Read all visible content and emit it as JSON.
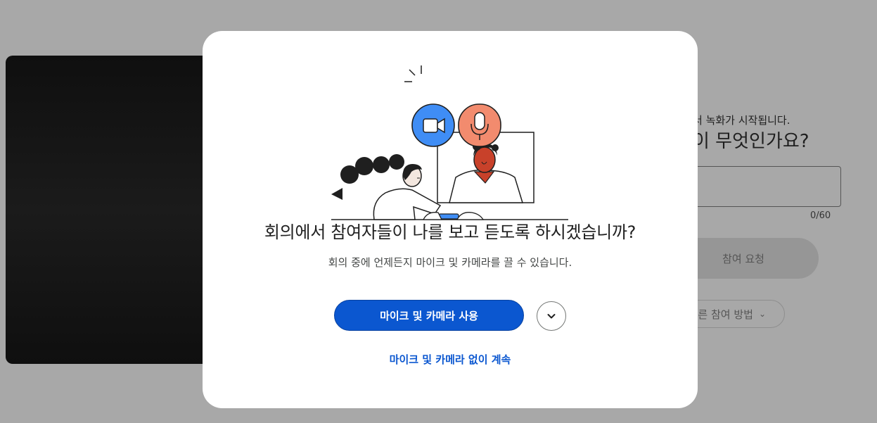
{
  "background": {
    "recording_notice": "서 녹화가 시작됩니다.",
    "name_question": "이 무엇인가요?",
    "name_counter": "0/60",
    "join_button_label": "참여 요청",
    "other_ways_label": "른 참여 방법"
  },
  "modal": {
    "title": "회의에서 참여자들이 나를 보고 듣도록 하시겠습니까?",
    "subtitle": "회의 중에 언제든지 마이크 및 카메라를 끌 수 있습니다.",
    "primary_button_label": "마이크 및 카메라 사용",
    "secondary_link_label": "마이크 및 카메라 없이 계속"
  },
  "icons": {
    "camera": "video-camera-icon",
    "mic": "microphone-icon",
    "dropdown": "chevron-down-icon"
  },
  "colors": {
    "accent": "#0b57d0",
    "camera_badge": "#3f8df5",
    "mic_badge": "#f28b6e"
  }
}
